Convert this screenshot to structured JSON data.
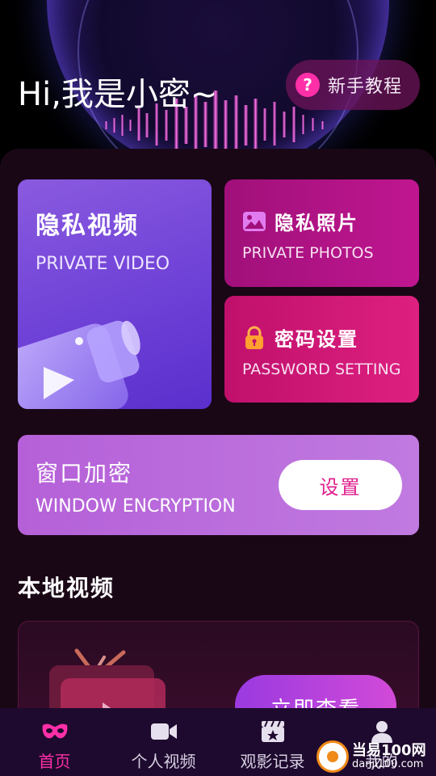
{
  "header": {
    "greeting": "Hi,我是小密~",
    "tutorial_button": {
      "icon": "question-icon",
      "glyph": "?",
      "label": "新手教程"
    }
  },
  "cards": {
    "private_video": {
      "title": "隐私视频",
      "subtitle": "PRIVATE VIDEO"
    },
    "private_photos": {
      "icon": "image-icon",
      "title": "隐私照片",
      "subtitle": "PRIVATE PHOTOS"
    },
    "password_setting": {
      "icon": "lock-icon",
      "title": "密码设置",
      "subtitle": "PASSWORD SETTING"
    },
    "window_encryption": {
      "title": "窗口加密",
      "subtitle": "WINDOW ENCRYPTION",
      "button_label": "设置"
    }
  },
  "local_videos": {
    "section_title": "本地视频",
    "button_label": "立即查看"
  },
  "bottom_nav": {
    "items": [
      {
        "label": "首页",
        "icon": "mask-icon",
        "active": true
      },
      {
        "label": "个人视频",
        "icon": "video-camera-icon",
        "active": false
      },
      {
        "label": "观影记录",
        "icon": "clapperboard-icon",
        "active": false
      },
      {
        "label": "我的",
        "icon": "user-icon",
        "active": false
      }
    ]
  },
  "watermark": {
    "line1": "当易100网",
    "line2": "danji100.com"
  },
  "colors": {
    "accent": "#ff2fa8",
    "background": "#1a0716",
    "video_card": "#6c3fd6",
    "photos_card": "#b0138a",
    "password_card": "#d01876",
    "window_card": "#bb6ddc",
    "nav_background": "#1e0a2e"
  }
}
